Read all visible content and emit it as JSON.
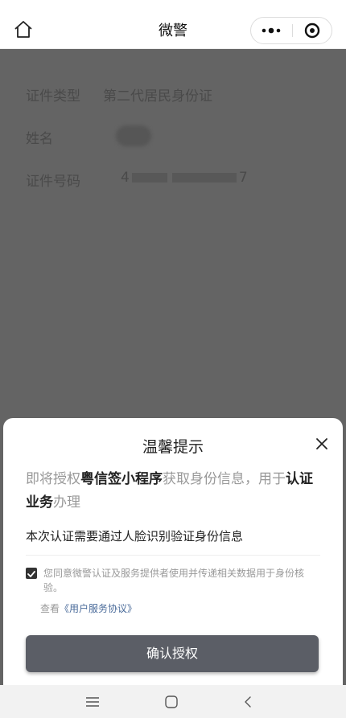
{
  "header": {
    "title": "微警",
    "icons": {
      "home": "home-icon",
      "more": "more-dots-icon",
      "close": "target-close-icon"
    }
  },
  "info": {
    "doc_type_label": "证件类型",
    "doc_type_value": "第二代居民身份证",
    "name_label": "姓名",
    "id_label": "证件号码",
    "id_start": "4",
    "id_end": "7"
  },
  "sheet": {
    "title": "温馨提示",
    "auth_prefix": "即将授权",
    "app_name": "粤信签小程序",
    "auth_middle": "获取身份信息，用于",
    "auth_purpose": "认证业务",
    "auth_suffix": "办理",
    "face_notice": "本次认证需要通过人脸识别验证身份信息",
    "agree_text": "您同意微警认证及服务提供者使用并传递相关数据用于身份核验。",
    "view_prefix": "查看",
    "agreement_link": "《用户服务协议》",
    "confirm_label": "确认授权",
    "agree_checked": true
  },
  "colors": {
    "overlay": "#646464",
    "button": "#5b5e66",
    "link": "#4a6b9a"
  },
  "system_nav": {
    "icons": [
      "menu-icon",
      "home-square-icon",
      "back-icon"
    ]
  }
}
